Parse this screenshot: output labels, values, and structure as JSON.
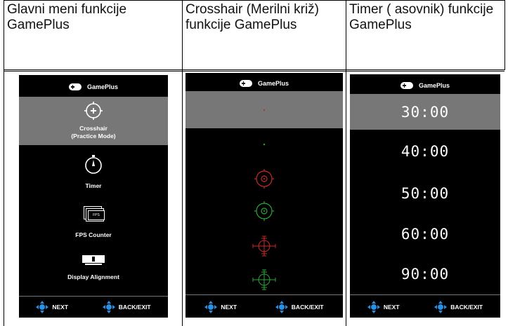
{
  "headers": {
    "col1": "Glavni meni funkcije GamePlus",
    "col2": "Crosshair (Merilni križ) funkcije GamePlus",
    "col3": "Timer ( asovnik) funkcije GamePlus"
  },
  "osd_title": "GamePlus",
  "main_menu": {
    "items": [
      {
        "label": "Crosshair\n(Practice Mode)",
        "icon": "crosshair-icon"
      },
      {
        "label": "Timer",
        "icon": "timer-icon"
      },
      {
        "label": "FPS Counter",
        "icon": "fps-icon",
        "icon_text": "FPS"
      },
      {
        "label": "Display Alignment",
        "icon": "display-alignment-icon"
      }
    ]
  },
  "crosshair_menu": {
    "options": [
      {
        "style": "dot",
        "color": "#c62a2a"
      },
      {
        "style": "dot",
        "color": "#2fa43a"
      },
      {
        "style": "circle",
        "color": "#c62a2a"
      },
      {
        "style": "circle",
        "color": "#2fa43a"
      },
      {
        "style": "scope",
        "color": "#c62a2a"
      },
      {
        "style": "scope",
        "color": "#2fa43a"
      }
    ]
  },
  "timer_menu": {
    "values": [
      "30:00",
      "40:00",
      "50:00",
      "60:00",
      "90:00"
    ]
  },
  "nav": {
    "next": "NEXT",
    "back": "BACK/EXIT"
  },
  "colors": {
    "highlight": "#777777",
    "dpad_blue": "#2a8fe0"
  }
}
